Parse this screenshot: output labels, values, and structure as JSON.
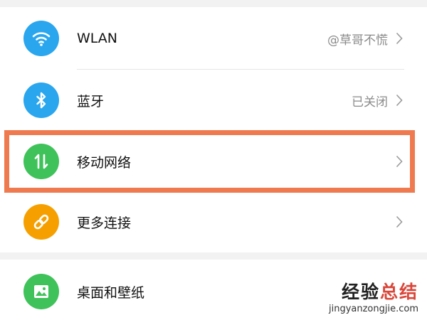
{
  "settings": {
    "connectivity": [
      {
        "label": "WLAN",
        "value": "@草哥不慌",
        "icon": "wifi-icon",
        "color": "#2aa6ee"
      },
      {
        "label": "蓝牙",
        "value": "已关闭",
        "icon": "bluetooth-icon",
        "color": "#2aa6ee"
      },
      {
        "label": "移动网络",
        "value": "",
        "icon": "mobile-data-icon",
        "color": "#3fc25a",
        "highlighted": true
      },
      {
        "label": "更多连接",
        "value": "",
        "icon": "link-icon",
        "color": "#f5a000"
      }
    ],
    "display": [
      {
        "label": "桌面和壁纸",
        "icon": "wallpaper-icon",
        "color": "#3fc25a"
      }
    ]
  },
  "watermark": {
    "title_part1": "经验",
    "title_part2": "总结",
    "url": "jingyanzongjie.com"
  },
  "colors": {
    "highlight_border": "#ef7a4f",
    "blue_icon": "#2aa6ee",
    "green_icon": "#3fc25a",
    "orange_icon": "#f5a000"
  }
}
